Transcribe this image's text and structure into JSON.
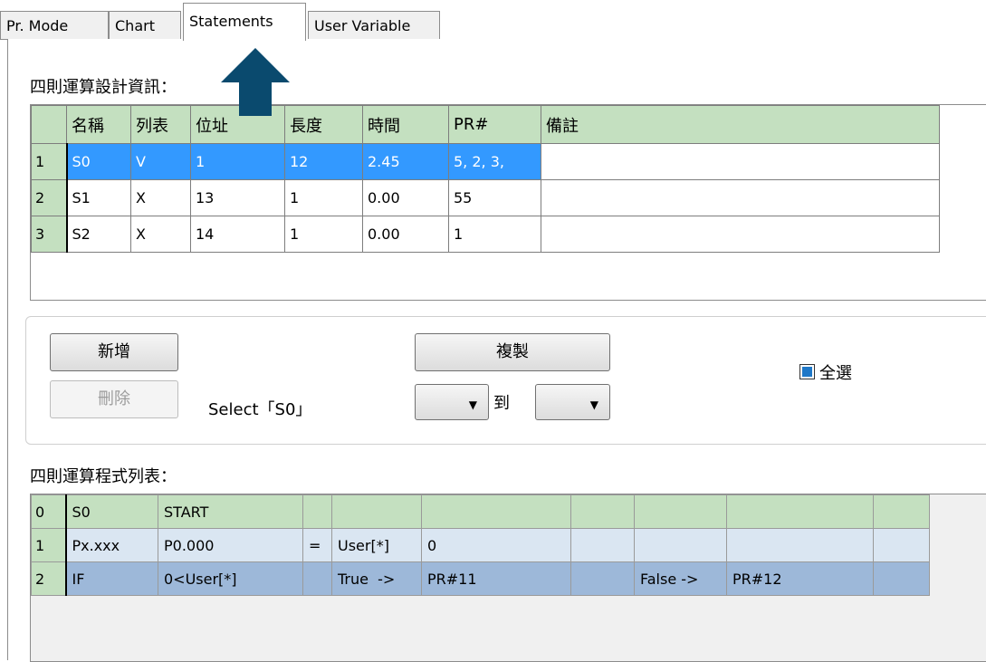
{
  "tabs": [
    {
      "label": "Pr. Mode"
    },
    {
      "label": "Chart"
    },
    {
      "label": "Statements"
    },
    {
      "label": "User Variable"
    }
  ],
  "active_tab": "Statements",
  "top_section": {
    "title": "四則運算設計資訊：",
    "columns": [
      "名稱",
      "列表",
      "位址",
      "長度",
      "時間",
      "PR#",
      "備註"
    ],
    "rows": [
      {
        "index": "1",
        "cells": [
          "S0",
          "V",
          "1",
          "12",
          "2.45",
          "5, 2, 3,",
          ""
        ]
      },
      {
        "index": "2",
        "cells": [
          "S1",
          "X",
          "13",
          "1",
          "0.00",
          "55",
          ""
        ]
      },
      {
        "index": "3",
        "cells": [
          "S2",
          "X",
          "14",
          "1",
          "0.00",
          "1",
          ""
        ]
      }
    ],
    "selected_row": 0
  },
  "controls": {
    "add_label": "新增",
    "delete_label": "刪除",
    "select_text": "Select「S0」",
    "copy_label": "複製",
    "to_label": "到",
    "select_all_label": "全選",
    "select_all_checked": true,
    "from_combo_value": "",
    "to_combo_value": ""
  },
  "program_section": {
    "title": "四則運算程式列表：",
    "rows": [
      {
        "index": "0",
        "cells": [
          "S0",
          "START",
          "",
          "",
          "",
          "",
          "",
          "",
          ""
        ]
      },
      {
        "index": "1",
        "cells": [
          "Px.xxx",
          "P0.000",
          "=",
          "User[*]",
          "0",
          "",
          "",
          "",
          ""
        ]
      },
      {
        "index": "2",
        "cells": [
          "IF",
          "0<User[*]",
          "",
          "True  ->",
          "PR#11",
          "",
          "False ->",
          "PR#12",
          ""
        ]
      }
    ]
  },
  "colors": {
    "header_green": "#c4e0c0",
    "selection_blue": "#3399ff",
    "row_light_blue": "#dae6f2",
    "row_mid_blue": "#9db8d9",
    "arrow": "#0a4a6e"
  },
  "annotation": {
    "arrow_icon": "up-arrow-icon",
    "points_to": "Statements"
  }
}
